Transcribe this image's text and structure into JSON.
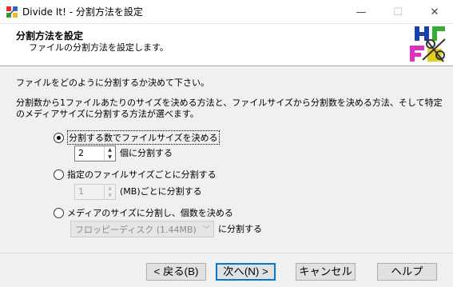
{
  "window": {
    "title": "Divide It! - 分割方法を設定",
    "minimize_glyph": "—",
    "maximize_glyph": "☐",
    "close_glyph": "✕"
  },
  "header": {
    "title": "分割方法を設定",
    "subtitle": "ファイルの分割方法を設定します。"
  },
  "body": {
    "intro": "ファイルをどのように分割するか決めて下さい。",
    "description": "分割数から1ファイルあたりのサイズを決める方法と、ファイルサイズから分割数を決める方法、そして特定のメディアサイズに分割する方法が選べます。"
  },
  "options": {
    "by_count": {
      "label": "分割する数でファイルサイズを決める",
      "selected": true,
      "value": "2",
      "suffix": "個に分割する"
    },
    "by_size": {
      "label": "指定のファイルサイズごとに分割する",
      "selected": false,
      "value": "1",
      "suffix": "(MB)ごとに分割する"
    },
    "by_media": {
      "label": "メディアのサイズに分割し、個数を決める",
      "selected": false,
      "media_value": "フロッピーディスク (1.44MB)",
      "suffix": "に分割する"
    }
  },
  "buttons": {
    "back": "< 戻る(B)",
    "next": "次へ(N) >",
    "cancel": "キャンセル",
    "help": "ヘルプ"
  },
  "icons": {
    "app": "divide-it-app-icon",
    "logo": "divide-it-logo-icon"
  }
}
